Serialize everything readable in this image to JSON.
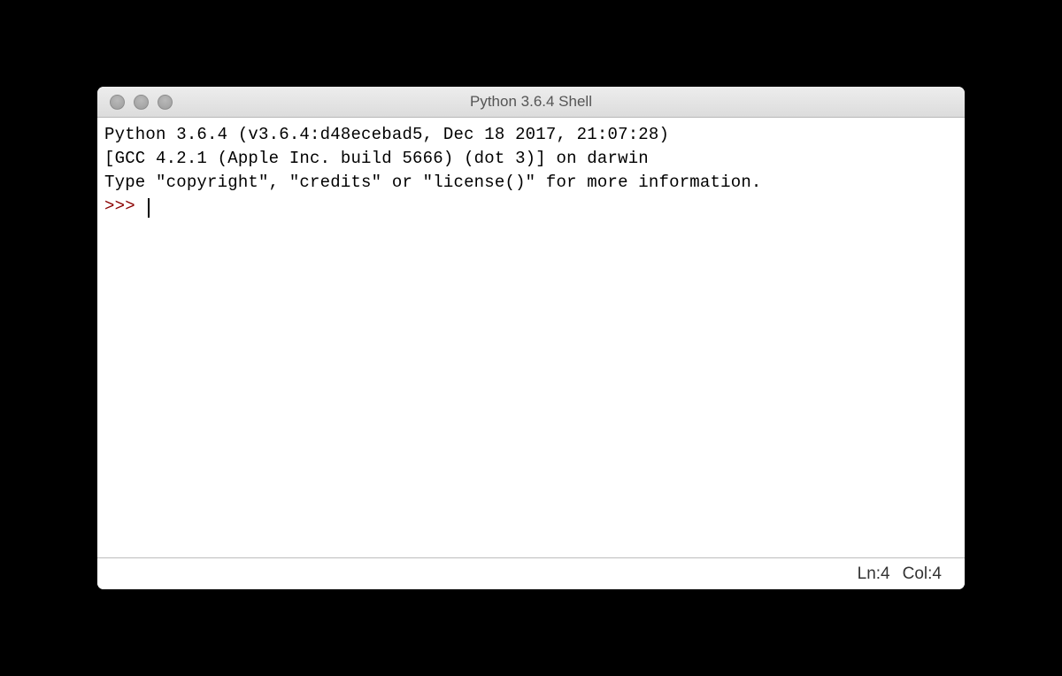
{
  "window": {
    "title": "Python 3.6.4 Shell"
  },
  "content": {
    "line1": "Python 3.6.4 (v3.6.4:d48ecebad5, Dec 18 2017, 21:07:28)",
    "line2": "[GCC 4.2.1 (Apple Inc. build 5666) (dot 3)] on darwin",
    "line3": "Type \"copyright\", \"credits\" or \"license()\" for more information.",
    "prompt": ">>> "
  },
  "statusbar": {
    "line_label": "Ln: ",
    "line_value": "4",
    "col_label": "Col: ",
    "col_value": "4"
  }
}
